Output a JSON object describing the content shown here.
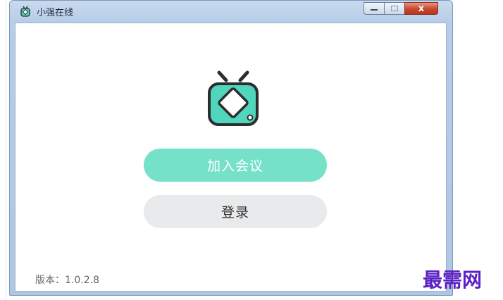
{
  "window": {
    "title": "小强在线",
    "controls": {
      "minimize": "",
      "maximize": "",
      "close": "x"
    }
  },
  "main": {
    "join_button_label": "加入会议",
    "login_button_label": "登录",
    "version_text": "版本：1.0.2.8"
  },
  "watermark": "最需网",
  "colors": {
    "accent": "#74e1c8",
    "logo_fill": "#4fd6bd",
    "logo_outline": "#2d2d2d",
    "login_bg": "#e9eaeb",
    "watermark": "#5b21c4"
  },
  "icons": [
    "tv-app-icon",
    "minimize-icon",
    "maximize-icon",
    "close-icon",
    "tv-logo-icon"
  ]
}
